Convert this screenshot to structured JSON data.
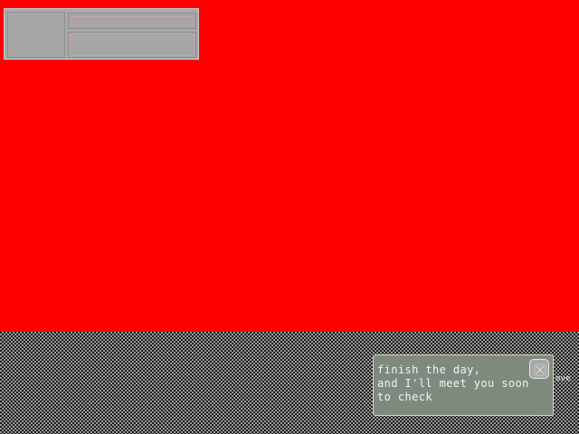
{
  "scene": {
    "background_color": "#ff0000",
    "floor_pattern": "checkerboard"
  },
  "hud": {
    "portrait_icon": "portrait-slot",
    "name_bar_icon": "name-bar",
    "info_panel_icon": "info-panel"
  },
  "dialogue": {
    "text": "finish the day,\nand I'll meet you soon\nto check",
    "close_icon": "close-icon",
    "side_label": "ove"
  }
}
